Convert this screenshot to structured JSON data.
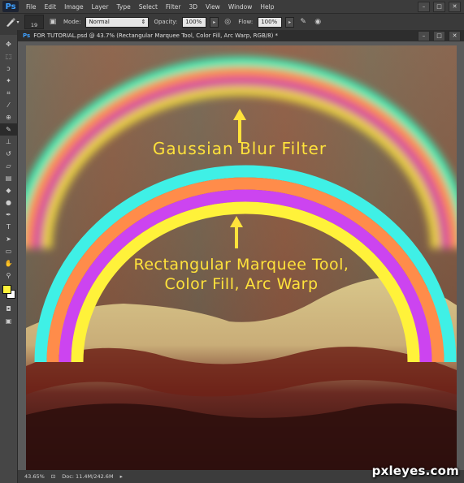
{
  "app": {
    "logo": "Ps",
    "menus": [
      "File",
      "Edit",
      "Image",
      "Layer",
      "Type",
      "Select",
      "Filter",
      "3D",
      "View",
      "Window",
      "Help"
    ]
  },
  "options": {
    "brush_size": "19",
    "mode_label": "Mode:",
    "mode_value": "Normal",
    "opacity_label": "Opacity:",
    "opacity_value": "100%",
    "flow_label": "Flow:",
    "flow_value": "100%"
  },
  "document": {
    "tab_title": "FOR TUTORIAL.psd @ 43.7% (Rectangular Marquee Tool, Color Fill, Arc Warp, RGB/8) *"
  },
  "canvas": {
    "label_top": "Gaussian Blur Filter",
    "label_bottom_line1": "Rectangular Marquee Tool,",
    "label_bottom_line2": "Color Fill, Arc Warp",
    "colors": {
      "cyan": "#3ff0e6",
      "orange": "#ff8c4a",
      "magenta": "#cc44f0",
      "yellow": "#fff23a",
      "text_yellow": "#ffe23b"
    }
  },
  "status": {
    "zoom": "43.65%",
    "doc_info": "Doc: 11.4M/242.6M"
  },
  "watermark": "pxleyes.com",
  "icons": {
    "toolbar": [
      "move-icon",
      "marquee-icon",
      "lasso-icon",
      "quick-select-icon",
      "crop-icon",
      "eyedropper-icon",
      "healing-icon",
      "brush-icon",
      "stamp-icon",
      "history-brush-icon",
      "eraser-icon",
      "gradient-icon",
      "blur-icon",
      "dodge-icon",
      "pen-icon",
      "type-icon",
      "path-select-icon",
      "shape-icon",
      "hand-icon",
      "zoom-icon"
    ]
  }
}
